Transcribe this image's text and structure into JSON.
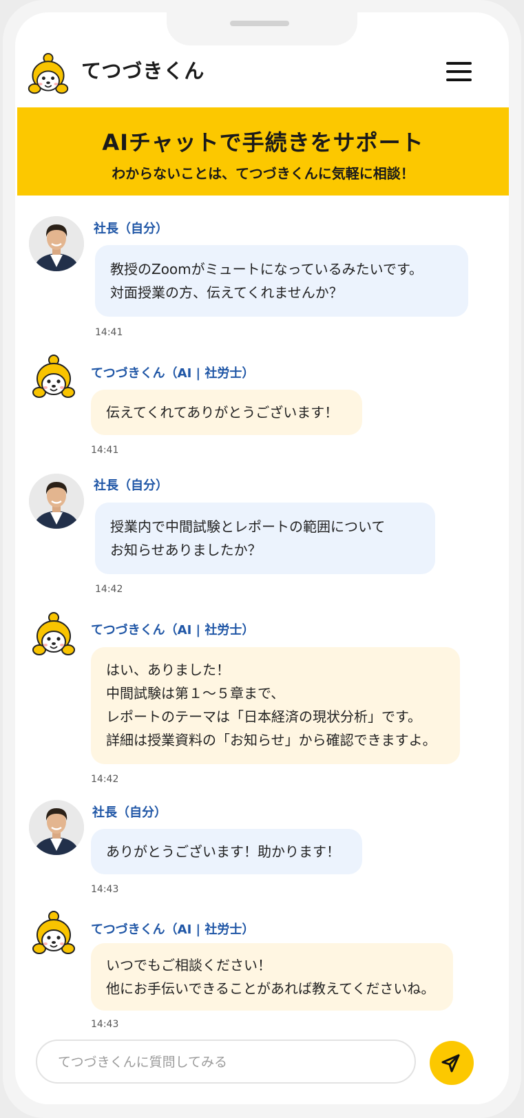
{
  "app": {
    "title": "てつづきくん"
  },
  "banner": {
    "title": "AIチャットで手続きをサポート",
    "subtitle": "わからないことは、てつづきくんに気軽に相談！"
  },
  "messages": [
    {
      "sender": "user",
      "name": "社長（自分）",
      "lines": [
        "教授のZoomがミュートになっているみたいです。",
        "対面授業の方、伝えてくれませんか？"
      ],
      "time": "14:41"
    },
    {
      "sender": "bot",
      "name": "てつづきくん（AI | 社労士）",
      "lines": [
        "伝えてくれてありがとうございます！"
      ],
      "time": "14:41"
    },
    {
      "sender": "user",
      "name": "社長（自分）",
      "lines": [
        "授業内で中間試験とレポートの範囲について",
        "お知らせありましたか？"
      ],
      "time": "14:42"
    },
    {
      "sender": "bot",
      "name": "てつづきくん（AI | 社労士）",
      "lines": [
        "はい、ありました！",
        "中間試験は第１～５章まで、",
        "レポートのテーマは「日本経済の現状分析」です。",
        "詳細は授業資料の「お知らせ」から確認できますよ。"
      ],
      "time": "14:42"
    },
    {
      "sender": "user",
      "name": "社長（自分）",
      "lines": [
        "ありがとうございます！助かります！"
      ],
      "time": "14:43"
    },
    {
      "sender": "bot",
      "name": "てつづきくん（AI | 社労士）",
      "lines": [
        "いつでもご相談ください！",
        "他にお手伝いできることがあれば教えてくださいね。"
      ],
      "time": "14:43"
    }
  ],
  "input": {
    "placeholder": "てつづきくんに質問してみる",
    "value": ""
  },
  "icons": {
    "menu": "hamburger-menu-icon",
    "send": "paper-plane-icon",
    "logo": "mascot-logo-icon"
  },
  "colors": {
    "brand_yellow": "#fcc800",
    "name_blue": "#1f56a6",
    "user_bubble": "#ecf3fd",
    "bot_bubble": "#fff6e2"
  }
}
